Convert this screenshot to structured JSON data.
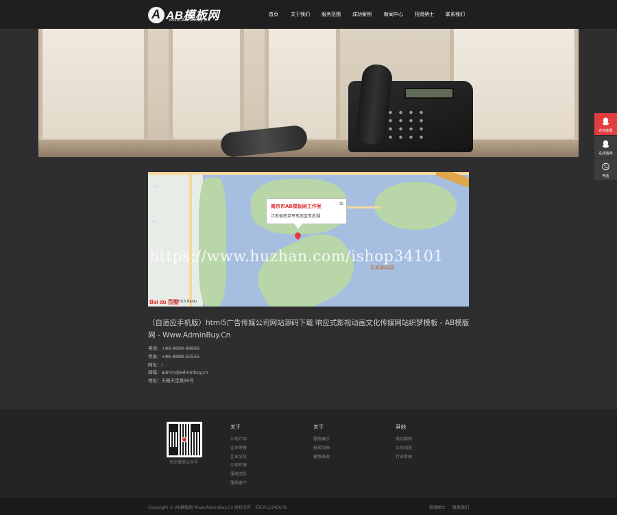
{
  "header": {
    "logo_title": "AB模板网",
    "logo_subtitle": "Www.AdminBuy.Cn",
    "nav": [
      "首页",
      "关于我们",
      "服务范围",
      "成功案例",
      "新闻中心",
      "招贤纳士",
      "联系我们"
    ]
  },
  "map": {
    "popup_title": "南京市AB模板网工作室",
    "popup_address": "江苏省南京市玄武区玄武湖",
    "close_symbol": "⊠",
    "lake_label": "玄武湖公园",
    "logo_text": "Bai du 百度",
    "copyright": "© 2015 Baidu"
  },
  "watermark": "https://www.huzhan.com/ishop34101",
  "content": {
    "title": "（自适应手机版）html5广告传媒公司网站源码下载 响应式影视动画文化传媒网站织梦模板 - AB模版网 - Www.AdminBuy.Cn",
    "contact": [
      "电话：+86-9999-66666",
      "传真：+86-8888-55555",
      "网址：/",
      "邮箱：admin@adminbuy.cn",
      "地址：天朝天堂路99号"
    ]
  },
  "footer": {
    "qr_caption": "关注微信公众号",
    "columns": [
      {
        "title": "关于",
        "links": [
          "公司介绍",
          "企业荣誉",
          "企业文化",
          "公司环境",
          "服务团队",
          "服务客户"
        ]
      },
      {
        "title": "关于",
        "links": [
          "服务展示",
          "影视动画",
          "建筑表现"
        ]
      },
      {
        "title": "其他",
        "links": [
          "成功案例",
          "公司动态",
          "行业新闻"
        ]
      }
    ],
    "copyright": "Copyright © AB模板网 Www.AdminBuy.Cn 版权所有",
    "icp": "苏ICP12345678",
    "bottom_links": [
      "招贤纳士",
      "联系我们"
    ]
  },
  "sidebar": {
    "items": [
      {
        "label": "在线客服",
        "icon": "qq-icon"
      },
      {
        "label": "在线咨询",
        "icon": "qq-icon"
      },
      {
        "label": "电话",
        "icon": "phone-icon"
      }
    ],
    "accent": "#e43d3d"
  }
}
